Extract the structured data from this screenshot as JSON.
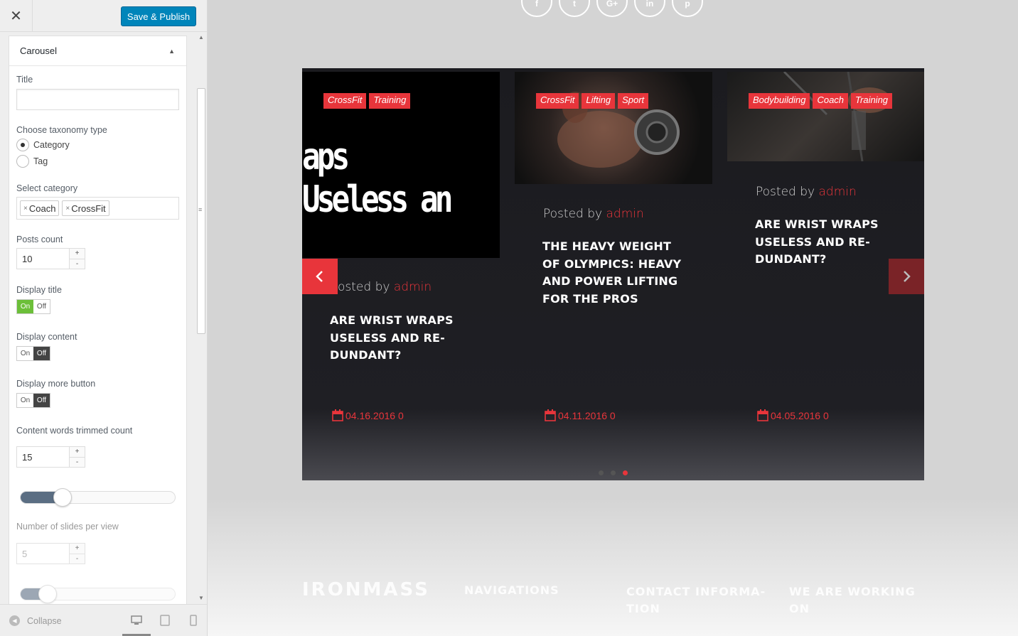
{
  "sidebar": {
    "close_icon": "close-icon",
    "save_label": "Save & Publish",
    "panel_title": "Carousel",
    "title_label": "Title",
    "title_value": "",
    "taxonomy_label": "Choose taxonomy type",
    "taxonomy_options": [
      "Category",
      "Tag"
    ],
    "taxonomy_selected": "Category",
    "category_label": "Select category",
    "categories": [
      "Coach",
      "CrossFit"
    ],
    "posts_count_label": "Posts count",
    "posts_count": "10",
    "display_title_label": "Display title",
    "display_title": true,
    "display_content_label": "Display content",
    "display_content": false,
    "display_more_label": "Display more button",
    "display_more": false,
    "toggle_on": "On",
    "toggle_off": "Off",
    "trim_label": "Content words trimmed count",
    "trim_count": "15",
    "slides_label": "Number of slides per view",
    "slides_count": "5",
    "collapse_label": "Collapse"
  },
  "preview": {
    "social_icons": [
      "f",
      "t",
      "G+",
      "in",
      "p"
    ],
    "slides": [
      {
        "tags": [
          "CrossFit",
          "Training"
        ],
        "image_text": "aps Useless an",
        "posted_prefix": "osted by",
        "author": "admin",
        "title": "ARE WRIST WRAPS USELESS AND RE-DUNDANT?",
        "date": "04.16.2016 0"
      },
      {
        "tags": [
          "CrossFit",
          "Lifting",
          "Sport"
        ],
        "posted_prefix": "Posted by",
        "author": "admin",
        "title": "THE HEAVY WEIGHT OF OLYMPICS: HEAVY AND POWER LIFTING FOR THE PROS",
        "date": "04.11.2016 0"
      },
      {
        "tags": [
          "Bodybuilding",
          "Coach",
          "Training"
        ],
        "posted_prefix": "Posted by",
        "author": "admin",
        "title": "ARE WRIST WRAPS USELESS AND RE-DUNDANT?",
        "date": "04.05.2016 0"
      }
    ],
    "active_dot": 2,
    "footer": {
      "logo": "IRONMASS",
      "col1": "NAVIGATIONS",
      "col2": "CONTACT INFORMA-TION",
      "col3": "WE ARE WORKING ON"
    }
  },
  "colors": {
    "accent": "#e8353b",
    "primary_button": "#0085ba",
    "toggle_on": "#6cbf39"
  }
}
